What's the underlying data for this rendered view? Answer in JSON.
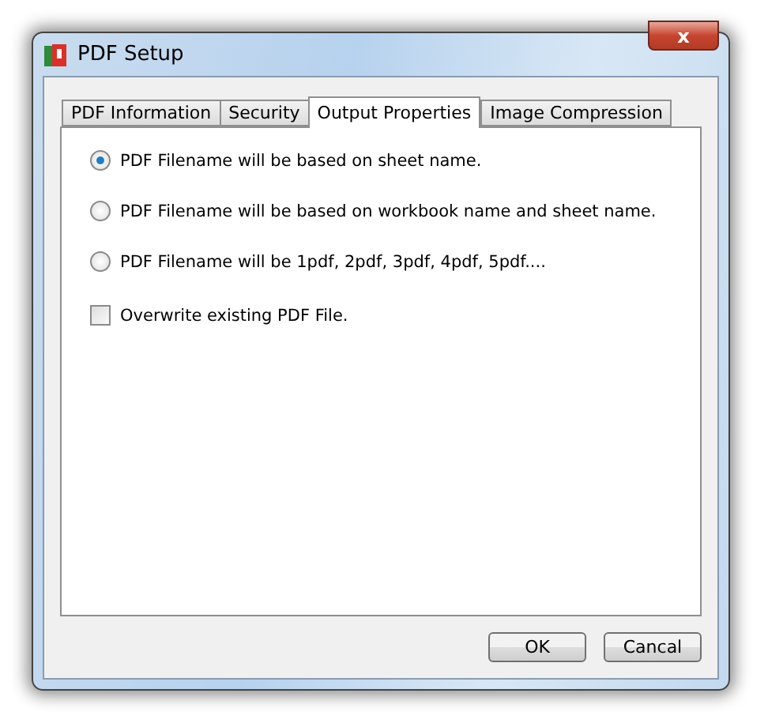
{
  "window": {
    "title": "PDF Setup",
    "close": "x"
  },
  "tabs": [
    {
      "label": "PDF Information",
      "selected": false
    },
    {
      "label": "Security",
      "selected": false
    },
    {
      "label": "Output Properties",
      "selected": true
    },
    {
      "label": "Image Compression",
      "selected": false
    }
  ],
  "options": [
    {
      "kind": "radio",
      "label": "PDF Filename will be based on sheet name.",
      "selected": true
    },
    {
      "kind": "radio",
      "label": "PDF Filename will be based on workbook name and sheet name.",
      "selected": false
    },
    {
      "kind": "radio",
      "label": "PDF Filename will be 1pdf, 2pdf, 3pdf, 4pdf, 5pdf....",
      "selected": false
    },
    {
      "kind": "checkbox",
      "label": "Overwrite existing PDF File.",
      "checked": false
    }
  ],
  "buttons": [
    "OK",
    "Cancal"
  ]
}
